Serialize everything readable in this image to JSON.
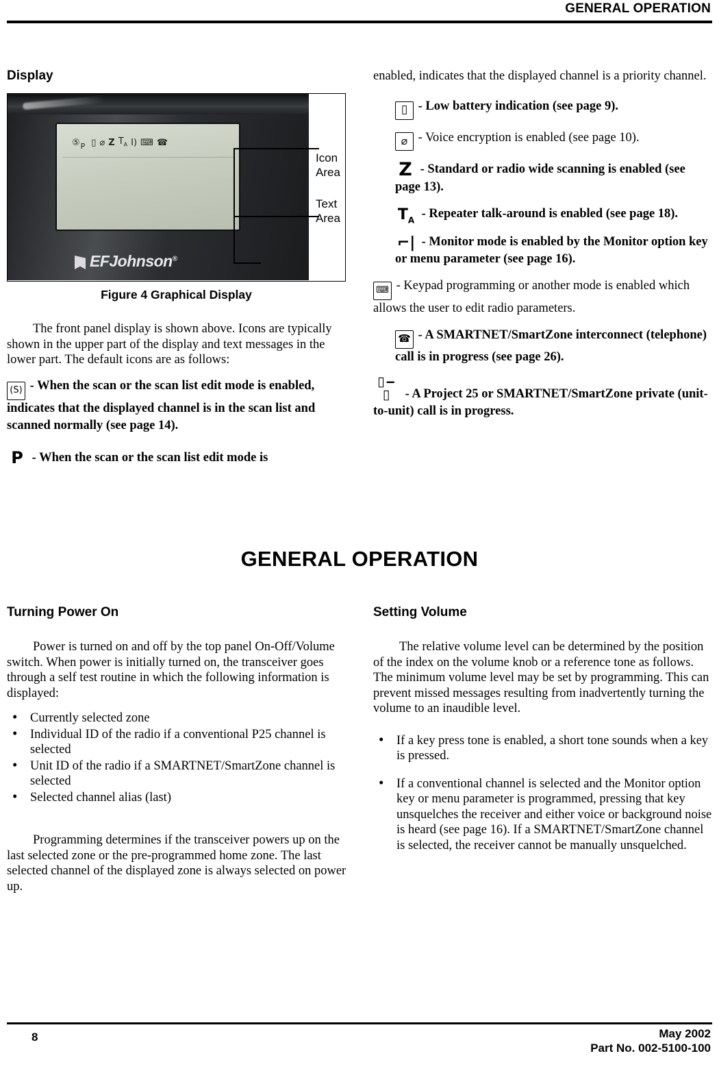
{
  "header": {
    "title": "GENERAL OPERATION"
  },
  "left_column": {
    "section_title": "Display",
    "figure": {
      "caption": "Figure 4   Graphical Display",
      "icon_area_label_line1": "Icon",
      "icon_area_label_line2": "Area",
      "text_area_label_line1": "Text",
      "text_area_label_line2": "Area",
      "brand": "EFJohnson",
      "brand_mark": "®",
      "lcd_icons": [
        "(S)",
        "P",
        "battery-icon",
        "key-icon",
        "Z",
        "TA",
        "monitor-icon",
        "keypad-icon",
        "phone-icon"
      ]
    },
    "paragraph_1": "The front panel display is shown above. Icons are typically shown in the upper part of the display and text messages in the lower part. The default icons are as follows:",
    "icon_items": [
      {
        "glyph": "(S)",
        "text": "- When the scan or the scan list edit mode is enabled, indicates that the displayed channel is in the scan list and scanned normally (see page 14)."
      },
      {
        "glyph": "P",
        "text": "- When the scan or the scan list edit mode is"
      }
    ]
  },
  "right_column": {
    "continued_text": "enabled, indicates that the displayed channel is a priority channel.",
    "icon_items": [
      {
        "glyph": "battery-icon",
        "text": "- Low battery indication (see page 9)."
      },
      {
        "glyph": "key-encryption-icon",
        "text": "- Voice encryption is enabled (see page 10)."
      },
      {
        "glyph": "Z",
        "text": "- Standard or radio wide scanning is enabled (see page 13)."
      },
      {
        "glyph": "TA",
        "text": "- Repeater talk-around is enabled (see page 18)."
      },
      {
        "glyph": "monitor-icon",
        "text": "- Monitor mode is enabled by the Monitor option key or menu parameter (see page 16)."
      },
      {
        "glyph": "keypad-icon",
        "text": "- Keypad programming or another mode is enabled which allows the user to edit radio parameters."
      },
      {
        "glyph": "phone-icon",
        "text": "- A SMARTNET/SmartZone interconnect (telephone) call is in progress (see page 26)."
      },
      {
        "glyph": "private-call-icon",
        "text": "- A Project 25 or SMARTNET/SmartZone private (unit-to-unit) call is in progress."
      }
    ]
  },
  "big_heading": "GENERAL OPERATION",
  "lower_left": {
    "section_title": "Turning Power On",
    "paragraph_1": "Power is turned on and off by the top panel On-Off/Volume switch. When power is initially turned on, the transceiver goes through a self test routine in which the following information is displayed:",
    "bullets": [
      "Currently selected zone",
      "Individual ID of the radio if a conventional P25 channel is selected",
      "Unit ID of the radio if a SMARTNET/SmartZone channel is selected",
      "Selected channel alias (last)"
    ],
    "paragraph_2": "Programming determines if the transceiver powers up on the last selected zone or the pre-programmed home zone. The last selected channel of the displayed zone is always selected on power up."
  },
  "lower_right": {
    "section_title": "Setting Volume",
    "paragraph_1": "The relative volume level can be determined by the position of the index on the volume knob or a reference tone as follows. The minimum volume level may be set by programming. This can prevent missed messages resulting from inadvertently turning the volume to an inaudible level.",
    "bullets": [
      "If a key press tone is enabled, a short tone sounds when a key is pressed.",
      "If a conventional channel is selected and the Monitor option key or menu parameter is programmed, pressing that key unsquelches the receiver and either voice or background noise is heard (see page 16). If a SMARTNET/SmartZone channel is selected, the receiver cannot be manually unsquelched."
    ]
  },
  "footer": {
    "page_number": "8",
    "date": "May 2002",
    "part_number": "Part No. 002-5100-100"
  }
}
